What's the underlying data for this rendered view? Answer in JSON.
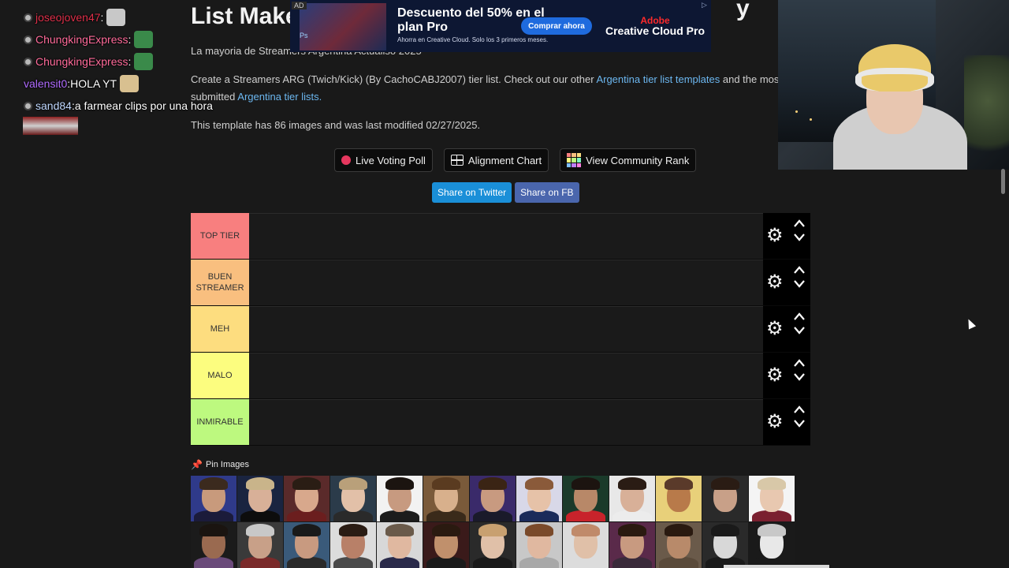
{
  "page": {
    "title": "List Make",
    "title_tail": "y",
    "subtitle": "La mayoria de Streamers Argentina Actualiso 2025",
    "desc_prefix": "Create a Streamers ARG (Twich/Kick) (By CachoCABJ2007) tier list. Check out our other",
    "desc_link1": "Argentina tier list templates",
    "desc_mid": "and the most rece",
    "desc_mid2": "submitted",
    "desc_link2": "Argentina tier lists.",
    "meta": "This template has 86 images and was last modified 02/27/2025."
  },
  "actions": {
    "live_voting": "Live Voting Poll",
    "alignment": "Alignment Chart",
    "community": "View Community Rank",
    "share_twitter": "Share on Twitter",
    "share_fb": "Share on FB"
  },
  "tiers": [
    {
      "label": "TOP TIER",
      "color": "#f87f7f"
    },
    {
      "label": "BUEN STREAMER",
      "color": "#f9bf7f"
    },
    {
      "label": "MEH",
      "color": "#fddd7f"
    },
    {
      "label": "MALO",
      "color": "#fcfd7f"
    },
    {
      "label": "INMIRABLE",
      "color": "#bdf97f"
    }
  ],
  "pin": {
    "label": "Pin Images",
    "icon": "pin-icon"
  },
  "images": {
    "count_visible": 26,
    "palette": [
      [
        "#2f3a8a",
        "#c89a7c",
        "#3b2a1e",
        "#1b1b3a"
      ],
      [
        "#1a2440",
        "#d8b098",
        "#c9b48a",
        "#0d0d0d"
      ],
      [
        "#5a2a2a",
        "#d8a88c",
        "#2a1d14",
        "#6b1e1e"
      ],
      [
        "#2b3b4a",
        "#e2c0a8",
        "#b9a07a",
        "#2a2a2a"
      ],
      [
        "#f2f2f2",
        "#c79a80",
        "#1b1410",
        "#1c1c1c"
      ],
      [
        "#7a5a3a",
        "#d8b08c",
        "#5a3b20",
        "#3a2a1a"
      ],
      [
        "#3a2a6a",
        "#c89a80",
        "#3a2414",
        "#1a1a2a"
      ],
      [
        "#d8d8e8",
        "#e6c2a8",
        "#8a5a3a",
        "#1b2b5a"
      ],
      [
        "#1a3a2a",
        "#b88868",
        "#1c1410",
        "#c8232b"
      ],
      [
        "#e8e8e8",
        "#d8b098",
        "#2a1c14",
        "#ececec"
      ],
      [
        "#e8d07a",
        "#b87a4a",
        "#5a3a2a",
        "#e8d07a"
      ],
      [
        "#2a2a2a",
        "#c8a088",
        "#2a1c14",
        "#2a2a2a"
      ],
      [
        "#f4f4f4",
        "#e8c8b0",
        "#d8c8a8",
        "#7a2030"
      ],
      [
        "#1b1b1b",
        "#9a6a50",
        "#1a1410",
        "#6a4a7a"
      ],
      [
        "#3a3a3a",
        "#c8a088",
        "#c8c8c8",
        "#7a2a2a"
      ],
      [
        "#3a5a7a",
        "#c89a80",
        "#1a1a1a",
        "#2a2a2a"
      ],
      [
        "#dcdcdc",
        "#b88068",
        "#2a1c14",
        "#4a4a4a"
      ],
      [
        "#d8d8d8",
        "#e0b8a0",
        "#6a5a4a",
        "#2a2a4a"
      ],
      [
        "#3a1a1a",
        "#c0906c",
        "#2a1a10",
        "#1a1a1a"
      ],
      [
        "#2a2a2a",
        "#e0c0a8",
        "#c8a070",
        "#1a1a1a"
      ],
      [
        "#c8c8c8",
        "#e0b8a0",
        "#7a4a2a",
        "#a8a8a8"
      ],
      [
        "#dcdcdc",
        "#e0c0a8",
        "#c08a6a",
        "#dcdcdc"
      ],
      [
        "#5a2a4a",
        "#c89a80",
        "#2a1a10",
        "#3a2a3a"
      ],
      [
        "#6a5a4a",
        "#b88a6a",
        "#2a1a10",
        "#5a4a3a"
      ],
      [
        "#2a2a2a",
        "#d8d8d8",
        "#1a1a1a",
        "#1a1a1a"
      ],
      [
        "#1a1a1a",
        "#e8e8e8",
        "#c8c8c8",
        "#1a1a1a"
      ]
    ]
  },
  "chat": [
    {
      "user": "joseojoven47",
      "color": "#e0304a",
      "msg": "",
      "emote": "#c8c8c8",
      "badge": true
    },
    {
      "user": "ChungkingExpress",
      "color": "#ff6b9a",
      "msg": "",
      "emote": "#3a8a4a",
      "badge": true
    },
    {
      "user": "ChungkingExpress",
      "color": "#ff6b9a",
      "msg": "",
      "emote": "#3a8a4a",
      "badge": true
    },
    {
      "user": "valensit0",
      "color": "#b06cff",
      "msg": "HOLA YT",
      "emote": "#d8c090",
      "badge": false
    },
    {
      "user": "sand84",
      "color": "#c0d8ff",
      "msg": "a farmear clips por una hora",
      "emote": "",
      "badge": true
    }
  ],
  "ad": {
    "tag": "AD",
    "headline": "Descuento del 50% en el plan Pro",
    "sub": "Ahorra en Creative Cloud. Solo los 3 primeros meses.",
    "button": "Comprar ahora",
    "brand_small": "Adobe",
    "brand": "Creative Cloud Pro",
    "app": "Ps"
  },
  "colors": {
    "background": "#191919",
    "link": "#6cb7f0",
    "twitter": "#1a8fd8",
    "facebook": "#4a66ad",
    "live_dot": "#e6375e"
  }
}
